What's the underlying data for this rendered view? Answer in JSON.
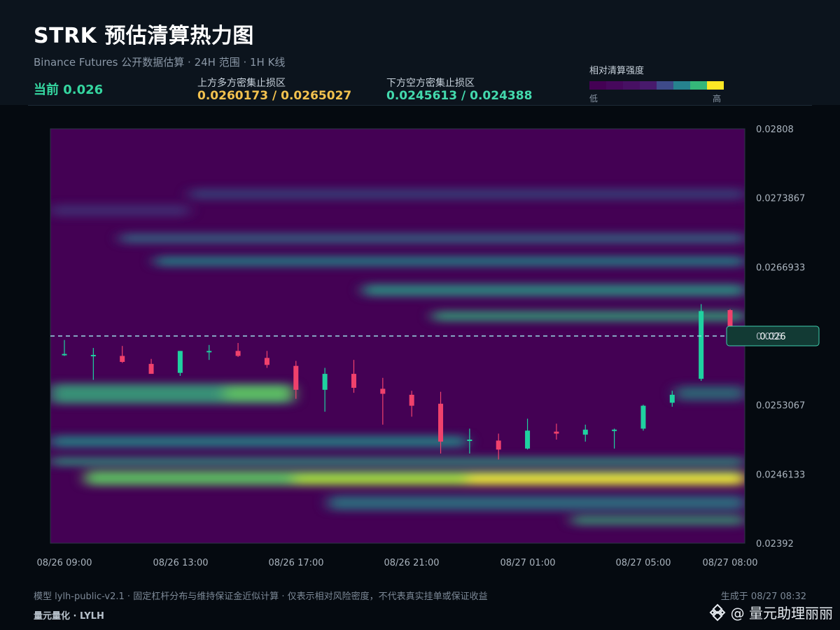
{
  "header": {
    "title": "STRK 预估清算热力图",
    "subtitle": "Binance Futures 公开数据估算 · 24H 范围 · 1H K线",
    "current_text": "当前 0.026",
    "upper_label": "上方多方密集止损区",
    "upper_value": "0.0260173 / 0.0265027",
    "lower_label": "下方空方密集止损区",
    "lower_value": "0.0245613 / 0.024388",
    "legend_title": "相对清算强度",
    "legend_low": "低",
    "legend_high": "高",
    "legend_colors": [
      "#440154",
      "#46085c",
      "#471063",
      "#481a6c",
      "#3e4a89",
      "#26828e",
      "#35b779",
      "#fde725"
    ]
  },
  "chart_data": {
    "type": "heatmap",
    "x_ticks": [
      "08/26 09:00",
      "08/26 13:00",
      "08/26 17:00",
      "08/26 21:00",
      "08/27 01:00",
      "08/27 05:00",
      "08/27 08:00"
    ],
    "y_ticks": [
      "0.02808",
      "0.0273867",
      "0.0266933",
      "0.026",
      "0.0253067",
      "0.0246133",
      "0.02392"
    ],
    "ylim": [
      0.02392,
      0.02808
    ],
    "current_price": 0.026,
    "current_label": "0.026",
    "up_color": "#1fd1a0",
    "down_color": "#f0416c",
    "bright_color": "#fde725",
    "candles": [
      {
        "o": 0.02582,
        "h": 0.02596,
        "l": 0.0258,
        "c": 0.02582
      },
      {
        "o": 0.02581,
        "h": 0.02588,
        "l": 0.02556,
        "c": 0.02581
      },
      {
        "o": 0.0258,
        "h": 0.0259,
        "l": 0.02573,
        "c": 0.02574
      },
      {
        "o": 0.02572,
        "h": 0.02577,
        "l": 0.02563,
        "c": 0.02562
      },
      {
        "o": 0.02563,
        "h": 0.02585,
        "l": 0.0256,
        "c": 0.02585
      },
      {
        "o": 0.02584,
        "h": 0.02591,
        "l": 0.02576,
        "c": 0.02585
      },
      {
        "o": 0.02585,
        "h": 0.02593,
        "l": 0.02579,
        "c": 0.0258
      },
      {
        "o": 0.02578,
        "h": 0.02585,
        "l": 0.02568,
        "c": 0.02571
      },
      {
        "o": 0.0257,
        "h": 0.02575,
        "l": 0.02537,
        "c": 0.02546
      },
      {
        "o": 0.02546,
        "h": 0.02568,
        "l": 0.02524,
        "c": 0.02562
      },
      {
        "o": 0.02562,
        "h": 0.02576,
        "l": 0.02543,
        "c": 0.02548
      },
      {
        "o": 0.02547,
        "h": 0.02558,
        "l": 0.02511,
        "c": 0.02542
      },
      {
        "o": 0.02541,
        "h": 0.02545,
        "l": 0.02519,
        "c": 0.0253
      },
      {
        "o": 0.02532,
        "h": 0.02544,
        "l": 0.02482,
        "c": 0.02494
      },
      {
        "o": 0.02495,
        "h": 0.02507,
        "l": 0.02482,
        "c": 0.02496
      },
      {
        "o": 0.02495,
        "h": 0.02502,
        "l": 0.02476,
        "c": 0.02486
      },
      {
        "o": 0.02487,
        "h": 0.02517,
        "l": 0.02486,
        "c": 0.02505
      },
      {
        "o": 0.02504,
        "h": 0.02512,
        "l": 0.02496,
        "c": 0.02502
      },
      {
        "o": 0.02501,
        "h": 0.02511,
        "l": 0.02494,
        "c": 0.02506
      },
      {
        "o": 0.02506,
        "h": 0.02507,
        "l": 0.02487,
        "c": 0.02506
      },
      {
        "o": 0.02507,
        "h": 0.02531,
        "l": 0.02505,
        "c": 0.0253
      },
      {
        "o": 0.02533,
        "h": 0.02545,
        "l": 0.02529,
        "c": 0.02541
      },
      {
        "o": 0.02557,
        "h": 0.02632,
        "l": 0.02555,
        "c": 0.02625
      },
      {
        "o": 0.02626,
        "h": 0.02627,
        "l": 0.02607,
        "c": 0.0261
      }
    ]
  },
  "footer": {
    "note": "模型 lylh-public-v2.1 · 固定杠杆分布与维持保证金近似计算 · 仅表示相对风险密度，不代表真实挂单或保证收益",
    "generated": "生成于 08/27 08:32",
    "brand": "量元量化 · LYLH",
    "watermark": "@ 量元助理丽丽"
  }
}
